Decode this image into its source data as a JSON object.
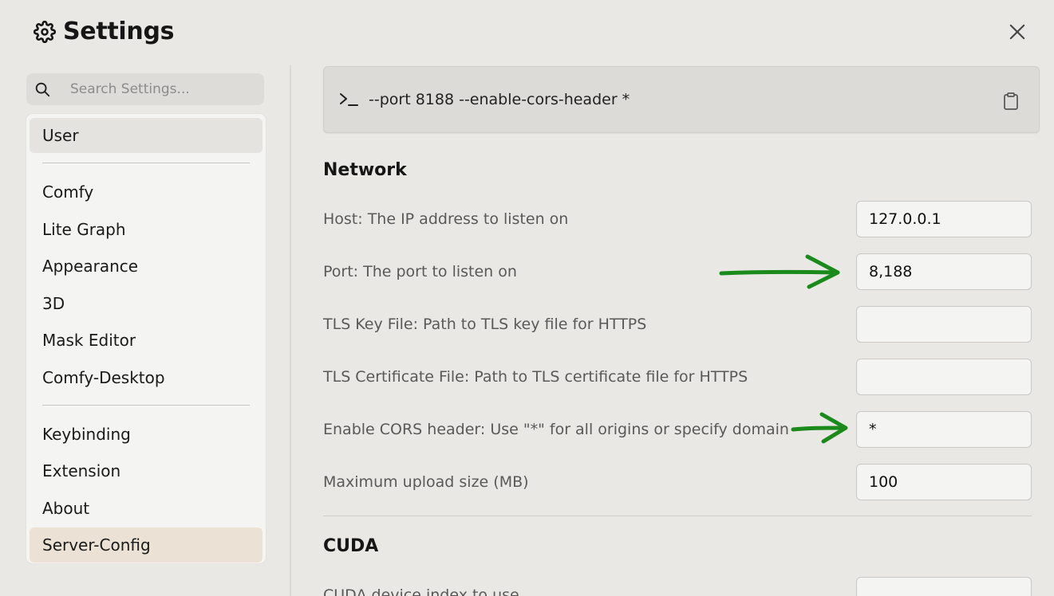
{
  "header": {
    "title": "Settings",
    "icon": "gear-icon"
  },
  "search": {
    "placeholder": "Search Settings..."
  },
  "sidebar": {
    "items": [
      {
        "label": "User"
      },
      {
        "label": "Comfy"
      },
      {
        "label": "Lite Graph"
      },
      {
        "label": "Appearance"
      },
      {
        "label": "3D"
      },
      {
        "label": "Mask Editor"
      },
      {
        "label": "Comfy-Desktop"
      },
      {
        "label": "Keybinding"
      },
      {
        "label": "Extension"
      },
      {
        "label": "About"
      },
      {
        "label": "Server-Config"
      }
    ],
    "active": "Server-Config"
  },
  "command": {
    "prompt_icon": "terminal-icon",
    "text": "--port 8188 --enable-cors-header *"
  },
  "network": {
    "title": "Network",
    "rows": [
      {
        "label": "Host: The IP address to listen on",
        "value": "127.0.0.1"
      },
      {
        "label": "Port: The port to listen on",
        "value": "8,188"
      },
      {
        "label": "TLS Key File: Path to TLS key file for HTTPS",
        "value": ""
      },
      {
        "label": "TLS Certificate File: Path to TLS certificate file for HTTPS",
        "value": ""
      },
      {
        "label": "Enable CORS header: Use \"*\" for all origins or specify domain",
        "value": "*"
      },
      {
        "label": "Maximum upload size (MB)",
        "value": "100"
      }
    ]
  },
  "cuda": {
    "title": "CUDA",
    "rows": [
      {
        "label": "CUDA device index to use",
        "value": ""
      }
    ]
  },
  "annotation_color": "#1a8a1a"
}
